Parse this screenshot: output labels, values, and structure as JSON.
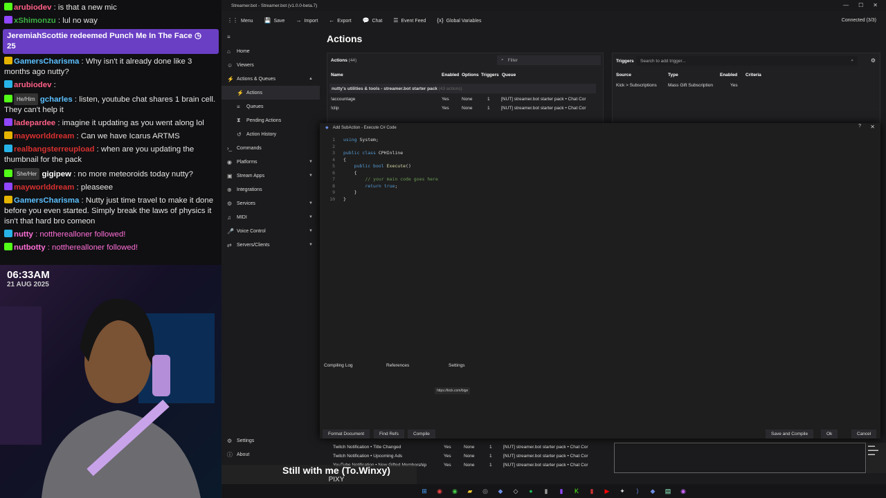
{
  "chat": {
    "messages": [
      {
        "user": "arubiodev",
        "text": " : is that a new mic",
        "color": "#ff5f86"
      },
      {
        "user": "xShimonzu",
        "text": " : lul no way",
        "color": "#3cb043"
      },
      {
        "user": "GamersCharisma",
        "text": " : Why isn't it already done like 3 months ago nutty?",
        "color": "#5bc0ff"
      },
      {
        "user": "arubiodev",
        "text": " : ",
        "color": "#ff5f86"
      },
      {
        "user": "gcharles",
        "text": " : listen, youtube chat shares 1 brain cell. They can't help it",
        "color": "#5bc0ff",
        "pill": "He/Him"
      },
      {
        "user": "ladepardee",
        "text": " : imagine it updating as you went along lol",
        "color": "#ff5f86"
      },
      {
        "user": "mayworlddream",
        "text": " : Can we have Icarus ARTMS",
        "color": "#d93030"
      },
      {
        "user": "realbangsterreupload",
        "text": " : when are you updating the thumbnail for the pack",
        "color": "#d93030"
      },
      {
        "user": "gigipew",
        "text": " : no more meteoroids today nutty?",
        "color": "#ffffff",
        "pill": "She/Her"
      },
      {
        "user": "mayworlddream",
        "text": " : pleaseee",
        "color": "#d93030"
      },
      {
        "user": "GamersCharisma",
        "text": " : Nutty just time travel to make it done before you even started. Simply break the laws of physics it isn't that hard bro comeon",
        "color": "#5bc0ff"
      },
      {
        "user": "nutty",
        "text": " : nottherealloner followed!",
        "color": "#ff6fd8"
      },
      {
        "user": "nutbotty",
        "text": " : nottherealloner followed!",
        "color": "#ff6fd8"
      }
    ],
    "redeem": "JeremiahScottie redeemed Punch Me In The Face",
    "redeem_cost": "25"
  },
  "cam": {
    "time": "06:33AM",
    "date": "21 AUG 2025"
  },
  "app": {
    "title": "Streamer.bot - Streamer.bot (v1.0.0-beta.7)",
    "menu": [
      "Menu",
      "Save",
      "Import",
      "Export",
      "Chat",
      "Event Feed",
      "Global Variables"
    ],
    "menu_icons": [
      "⋮⋮",
      "💾",
      "→",
      "←",
      "💬",
      "☰",
      "{x}"
    ],
    "connected": "Connected (3/3)",
    "sidebar": [
      {
        "label": "Home",
        "icon": "⌂",
        "sub": false
      },
      {
        "label": "Viewers",
        "icon": "☺",
        "sub": false
      },
      {
        "label": "Actions & Queues",
        "icon": "⚡",
        "sub": false,
        "chev": "▲"
      },
      {
        "label": "Actions",
        "icon": "⚡",
        "sub": true,
        "active": true
      },
      {
        "label": "Queues",
        "icon": "≡",
        "sub": true
      },
      {
        "label": "Pending Actions",
        "icon": "⧗",
        "sub": true
      },
      {
        "label": "Action History",
        "icon": "↺",
        "sub": true
      },
      {
        "label": "Commands",
        "icon": "›_",
        "sub": false
      },
      {
        "label": "Platforms",
        "icon": "◉",
        "sub": false,
        "chev": "▼"
      },
      {
        "label": "Stream Apps",
        "icon": "▣",
        "sub": false,
        "chev": "▼"
      },
      {
        "label": "Integrations",
        "icon": "⊕",
        "sub": false
      },
      {
        "label": "Services",
        "icon": "⚙",
        "sub": false,
        "chev": "▼"
      },
      {
        "label": "MIDI",
        "icon": "♫",
        "sub": false,
        "chev": "▼"
      },
      {
        "label": "Voice Control",
        "icon": "🎤",
        "sub": false,
        "chev": "▼"
      },
      {
        "label": "Servers/Clients",
        "icon": "⇄",
        "sub": false,
        "chev": "▼"
      }
    ],
    "sidebar_bottom": [
      "Settings",
      "About"
    ],
    "page_title": "Actions",
    "actions": {
      "title": "Actions",
      "count": "(44)",
      "filter_placeholder": "Filter",
      "columns": [
        "Name",
        "Enabled",
        "Options",
        "Triggers",
        "Queue"
      ],
      "group": "nutty's utilities & tools - streamer.bot starter pack",
      "group_count": "(43 actions)",
      "rows": [
        [
          "!accountage",
          "Yes",
          "None",
          "1",
          "[NUT] streamer.bot starter pack • Chat Cor"
        ],
        [
          "!clip",
          "Yes",
          "None",
          "1",
          "[NUT] streamer.bot starter pack • Chat Cor"
        ]
      ],
      "bottom_rows": [
        [
          "Twitch Notification • Title Changed",
          "Yes",
          "None",
          "1",
          "[NUT] streamer.bot starter pack • Chat Cor"
        ],
        [
          "Twitch Notification • Upcoming Ads",
          "Yes",
          "None",
          "1",
          "[NUT] streamer.bot starter pack • Chat Cor"
        ],
        [
          "YouTube Notification • New Gifted Membership",
          "Yes",
          "None",
          "1",
          "[NUT] streamer.bot starter pack • Chat Cor"
        ]
      ]
    },
    "triggers": {
      "title": "Triggers",
      "search_placeholder": "Search to add trigger...",
      "columns": [
        "Source",
        "Type",
        "Enabled",
        "Criteria"
      ],
      "rows": [
        [
          "Kick > Subscriptions",
          "Mass Gift Subscription",
          "Yes",
          ""
        ]
      ]
    },
    "dialog": {
      "title": "Add SubAction - Execute C# Code",
      "tabs": [
        "Compiling Log",
        "References",
        "Settings"
      ],
      "url": "https://kick.com/bige",
      "buttons_left": [
        "Format Document",
        "Find Refs",
        "Compile"
      ],
      "buttons_right": [
        "Save and Compile",
        "Ok",
        "Cancel"
      ]
    }
  },
  "caption": {
    "line1": "Still with me (To.Winxy)",
    "line2": "PIXY"
  }
}
